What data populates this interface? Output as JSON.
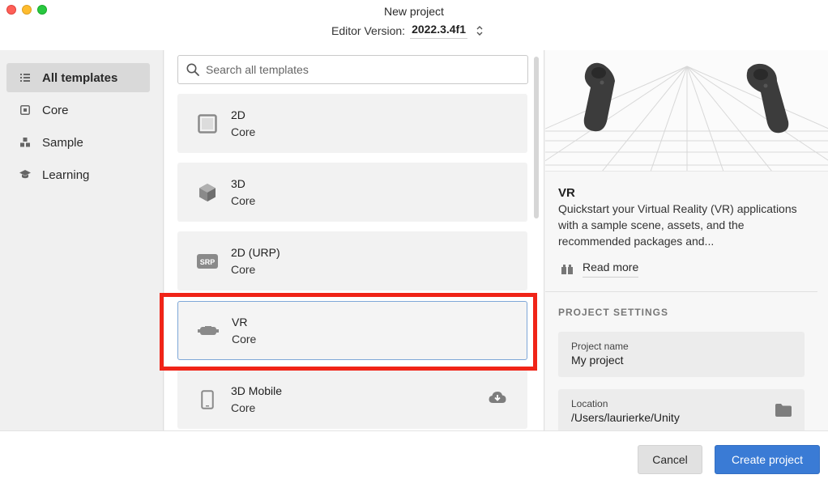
{
  "window": {
    "title": "New project",
    "editor_version_label": "Editor Version:",
    "editor_version": "2022.3.4f1"
  },
  "sidebar": {
    "items": [
      {
        "label": "All templates",
        "icon": "list-icon",
        "active": true
      },
      {
        "label": "Core",
        "icon": "core-icon",
        "active": false
      },
      {
        "label": "Sample",
        "icon": "sample-icon",
        "active": false
      },
      {
        "label": "Learning",
        "icon": "learning-icon",
        "active": false
      }
    ]
  },
  "search": {
    "placeholder": "Search all templates",
    "value": ""
  },
  "templates": [
    {
      "name": "2D",
      "category": "Core",
      "icon": "square-icon"
    },
    {
      "name": "3D",
      "category": "Core",
      "icon": "cube-icon"
    },
    {
      "name": "2D (URP)",
      "category": "Core",
      "icon": "srp-icon"
    },
    {
      "name": "VR",
      "category": "Core",
      "icon": "vr-headset-icon",
      "selected": true
    },
    {
      "name": "3D Mobile",
      "category": "Core",
      "icon": "mobile-icon",
      "download": true
    }
  ],
  "detail": {
    "title": "VR",
    "description": "Quickstart your Virtual Reality (VR) applications with a sample scene, assets, and the recommended packages and...",
    "read_more": "Read more",
    "settings_heading": "PROJECT SETTINGS",
    "project_name_label": "Project name",
    "project_name": "My project",
    "location_label": "Location",
    "location": "/Users/laurierke/Unity"
  },
  "footer": {
    "cancel_label": "Cancel",
    "create_label": "Create project"
  },
  "colors": {
    "accent": "#3a7bd5",
    "highlight": "#f02418",
    "selected_border": "#7ea7d8"
  }
}
